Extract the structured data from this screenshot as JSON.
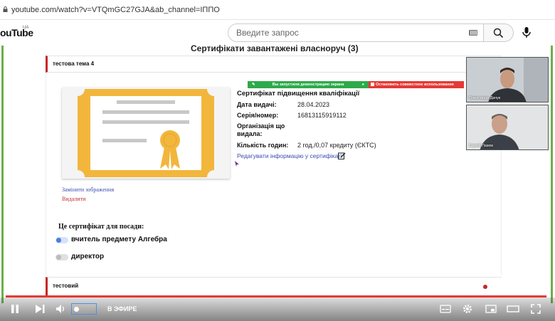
{
  "browser": {
    "url": "youtube.com/watch?v=VTQmGC27GJA&ab_channel=ІППО"
  },
  "youtube": {
    "logo": "YouTube",
    "logo_visible": "ouTube",
    "country": "UA",
    "search_placeholder": "Введите запрос"
  },
  "page": {
    "title": "Сертифікати завантажені власноруч (3)",
    "card1_title": "тестова тема 4",
    "card2_title": "тестовий",
    "replace_image": "Замінити зображення",
    "delete_image": "Видалити",
    "edit_link": "Редагувати інформацію у сертифікаті"
  },
  "screenshare": {
    "running": "Вы запустили демонстрацию экрана",
    "stop": "Остановить совместное использование"
  },
  "certificate": {
    "heading": "Сертифікат підвищення кваліфікації",
    "fields": [
      {
        "label": "Дата видачі:",
        "value": "28.04.2023"
      },
      {
        "label": "Серія/номер:",
        "value": "16813115919112"
      },
      {
        "label": "Організація що видала:",
        "value": ""
      },
      {
        "label": "Кількість годин:",
        "value": "2 год./0,07 кредиту (ЄКТС)"
      }
    ]
  },
  "position": {
    "label": "Це сертифікат для посади:",
    "options": [
      {
        "label": "вчитель предмету Алгебра",
        "active": true
      },
      {
        "label": "директор",
        "active": false
      }
    ]
  },
  "webcams": [
    {
      "name": "Олександр Дачук"
    },
    {
      "name": "Сергій Пазюк"
    }
  ],
  "player": {
    "live_label": "В ЭФИРЕ",
    "progress": 1.0
  },
  "colors": {
    "accent_red": "#c62828",
    "link_blue": "#3a4bb0",
    "green": "#2eaa4a",
    "cert_gold": "#f2b63c"
  },
  "icons": [
    "lock-icon",
    "keyboard-icon",
    "search-icon",
    "mic-icon",
    "edit-icon",
    "play-pause-icon",
    "next-icon",
    "volume-icon",
    "subtitles-icon",
    "settings-icon",
    "miniplayer-icon",
    "theater-icon",
    "fullscreen-icon"
  ]
}
